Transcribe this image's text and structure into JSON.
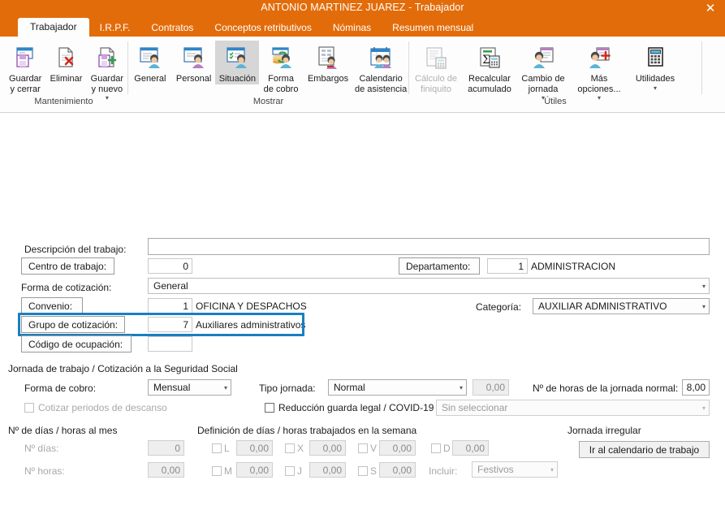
{
  "window": {
    "title": "ANTONIO MARTINEZ JUAREZ - Trabajador",
    "close_label": "✕"
  },
  "tabs": [
    {
      "label": "Trabajador",
      "active": true
    },
    {
      "label": "I.R.P.F.",
      "active": false
    },
    {
      "label": "Contratos",
      "active": false
    },
    {
      "label": "Conceptos retributivos",
      "active": false
    },
    {
      "label": "Nóminas",
      "active": false
    },
    {
      "label": "Resumen mensual",
      "active": false
    }
  ],
  "ribbon": {
    "groups": [
      {
        "title": "Mantenimiento",
        "buttons": [
          {
            "label": "Guardar\ny cerrar",
            "icon": "save-close-icon",
            "state": "normal",
            "caret": false
          },
          {
            "label": "Eliminar",
            "icon": "delete-document-icon",
            "state": "normal",
            "caret": false
          },
          {
            "label": "Guardar\ny nuevo",
            "icon": "save-new-icon",
            "state": "normal",
            "caret": true
          }
        ]
      },
      {
        "title": "Mostrar",
        "buttons": [
          {
            "label": "General",
            "icon": "general-person-icon",
            "state": "normal",
            "caret": false
          },
          {
            "label": "Personal",
            "icon": "personal-person-icon",
            "state": "normal",
            "caret": false
          },
          {
            "label": "Situación",
            "icon": "situacion-person-icon",
            "state": "selected",
            "caret": false
          },
          {
            "label": "Forma\nde cobro",
            "icon": "forma-de-cobro-icon",
            "state": "normal",
            "caret": false
          },
          {
            "label": "Embargos",
            "icon": "embargos-icon",
            "state": "normal",
            "caret": false
          },
          {
            "label": "Calendario\nde asistencia",
            "icon": "calendario-asistencia-icon",
            "state": "normal",
            "caret": false
          }
        ]
      },
      {
        "title": "Útiles",
        "buttons": [
          {
            "label": "Cálculo de\nfiniquito",
            "icon": "calculo-finiquito-icon",
            "state": "disabled",
            "caret": false
          },
          {
            "label": "Recalcular\nacumulado",
            "icon": "recalcular-acumulado-icon",
            "state": "normal",
            "caret": false
          },
          {
            "label": "Cambio de\njornada",
            "icon": "cambio-jornada-icon",
            "state": "normal",
            "caret": true
          },
          {
            "label": "Más\nopciones...",
            "icon": "mas-opciones-icon",
            "state": "normal",
            "caret": true
          },
          {
            "label": "Utilidades",
            "icon": "calculator-icon",
            "state": "normal",
            "caret": true
          }
        ]
      }
    ]
  },
  "form": {
    "descripcion_label": "Descripción del trabajo:",
    "descripcion_value": "",
    "centro_trabajo_label": "Centro de trabajo:",
    "centro_trabajo_value": "0",
    "departamento_label": "Departamento:",
    "departamento_value": "1",
    "departamento_name": "ADMINISTRACION",
    "forma_cotizacion_label": "Forma de cotización:",
    "forma_cotizacion_value": "General",
    "convenio_label": "Convenio:",
    "convenio_value": "1",
    "convenio_name": "OFICINA Y DESPACHOS",
    "categoria_label": "Categoría:",
    "categoria_value": "AUXILIAR ADMINISTRATIVO",
    "grupo_cotizacion_label": "Grupo de cotización:",
    "grupo_cotizacion_value": "7",
    "grupo_cotizacion_name": "Auxiliares administrativos",
    "codigo_ocupacion_label": "Código de ocupación:",
    "codigo_ocupacion_value": "",
    "highlight_color": "#1a7fc1"
  },
  "jornada": {
    "section_title": "Jornada de trabajo / Cotización a la Seguridad Social",
    "forma_cobro_label": "Forma de cobro:",
    "forma_cobro_value": "Mensual",
    "cotizar_descanso_label": "Cotizar periodos de descanso",
    "cotizar_descanso_checked": false,
    "tipo_jornada_label": "Tipo jornada:",
    "tipo_jornada_value": "Normal",
    "tipo_jornada_num": "0,00",
    "horas_jornada_label": "Nº de horas de la jornada normal:",
    "horas_jornada_value": "8,00",
    "reduccion_label": "Reducción guarda legal / COVID-19",
    "reduccion_checked": false,
    "reduccion_combo_value": "Sin seleccionar"
  },
  "dias_horas": {
    "section_title": "Nº de días / horas al mes",
    "dias_label": "Nº días:",
    "dias_value": "0",
    "horas_label": "Nº horas:",
    "horas_value": "0,00"
  },
  "semana": {
    "section_title": "Definición de días / horas trabajados en la semana",
    "days": [
      {
        "key": "L",
        "value": "0,00",
        "checked": false
      },
      {
        "key": "M",
        "value": "0,00",
        "checked": false
      },
      {
        "key": "X",
        "value": "0,00",
        "checked": false
      },
      {
        "key": "J",
        "value": "0,00",
        "checked": false
      },
      {
        "key": "V",
        "value": "0,00",
        "checked": false
      },
      {
        "key": "S",
        "value": "0,00",
        "checked": false
      },
      {
        "key": "D",
        "value": "0,00",
        "checked": false
      }
    ],
    "incluir_label": "Incluir:",
    "incluir_value": "Festivos"
  },
  "jornada_irregular": {
    "section_title": "Jornada irregular",
    "button_label": "Ir al calendario de trabajo"
  }
}
